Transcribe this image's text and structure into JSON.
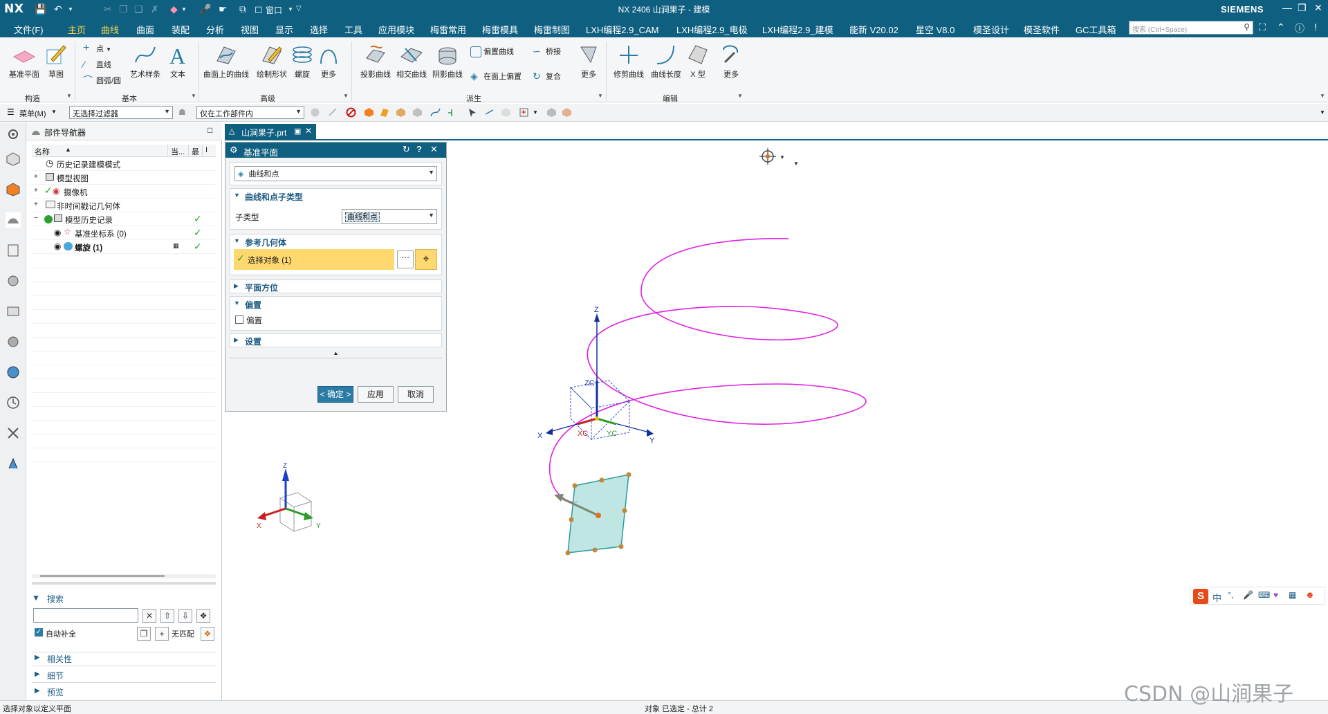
{
  "titlebar": {
    "logo": "NX",
    "title": "NX 2406 山涧果子 - 建模",
    "brand": "SIEMENS",
    "menu_label": "窗口"
  },
  "menu_tabs": [
    "文件(F)",
    "主页",
    "曲线",
    "曲面",
    "装配",
    "分析",
    "视图",
    "显示",
    "选择",
    "工具",
    "应用模块",
    "梅雷常用",
    "梅雷模具",
    "梅雷制图",
    "LXH编程2.9_CAM",
    "LXH编程2.9_电极",
    "LXH编程2.9_建模",
    "能新 V20.02",
    "星空 V8.0",
    "模圣设计",
    "模圣软件",
    "GC工具箱"
  ],
  "active_tab": "曲线",
  "search_placeholder": "搜索 (Ctrl+Space)",
  "ribbon": {
    "construct": {
      "datum_plane": "基准平面",
      "sketch": "草图",
      "group": "构造"
    },
    "basic": {
      "point": "点",
      "line": "直线",
      "arc": "圆弧/圆",
      "art_spline": "艺术样条",
      "text": "文本",
      "group": "基本"
    },
    "advanced": {
      "curve_on_surface": "曲面上的曲线",
      "law_shape": "绘制形状",
      "helix": "螺旋",
      "more": "更多",
      "group": "高级"
    },
    "derived": {
      "project": "投影曲线",
      "intersect": "相交曲线",
      "isoparametric": "阴影曲线",
      "offset_curve": "偏置曲线",
      "bridge": "桥接",
      "offset_in_face": "在面上偏置",
      "composite": "复合",
      "more": "更多",
      "group": "派生"
    },
    "edit": {
      "trim": "修剪曲线",
      "length": "曲线长度",
      "x_form": "X 型",
      "more": "更多",
      "group": "编辑"
    }
  },
  "selbar": {
    "menu": "菜单(M)",
    "filter": "无选择过滤器",
    "scope": "仅在工作部件内"
  },
  "part_navigator": {
    "title": "部件导航器",
    "col_name": "名称",
    "col_current": "当...",
    "col_latest": "最",
    "col_extra": "I",
    "rows": [
      {
        "label": "历史记录建模模式"
      },
      {
        "label": "模型视图"
      },
      {
        "label": "摄像机"
      },
      {
        "label": "非时间戳记几何体"
      },
      {
        "label": "模型历史记录"
      },
      {
        "label": "基准坐标系 (0)"
      },
      {
        "label": "螺旋 (1)"
      }
    ],
    "search_title": "搜索",
    "auto_complete": "自动补全",
    "no_match": "无匹配",
    "sections": [
      "相关性",
      "细节",
      "预览"
    ]
  },
  "viewport_tab": "山涧果子.prt",
  "dialog": {
    "title": "基准平面",
    "type_value": "曲线和点",
    "sec1_title": "曲线和点子类型",
    "subtype_label": "子类型",
    "subtype_value": "曲线和点",
    "sec2_title": "参考几何体",
    "select_label": "选择对象 (1)",
    "sec3_title": "平面方位",
    "sec4_title": "偏置",
    "offset_checkbox": "偏置",
    "sec5_title": "设置",
    "ok": "< 确定 >",
    "apply": "应用",
    "cancel": "取消"
  },
  "axes": {
    "Z": "Z",
    "X": "X",
    "Y": "Y",
    "ZC": "ZC",
    "XC": "XC",
    "YC": "YC"
  },
  "status": {
    "left": "选择对象以定义平面",
    "center": "对象 已选定 - 总计 2"
  },
  "watermark": "CSDN @山涧果子",
  "ime_label": "中",
  "colors": {
    "accent": "#0f5f80",
    "helix": "#e020e0",
    "highlight": "#ffd870",
    "plane": "#a9ddd8"
  }
}
